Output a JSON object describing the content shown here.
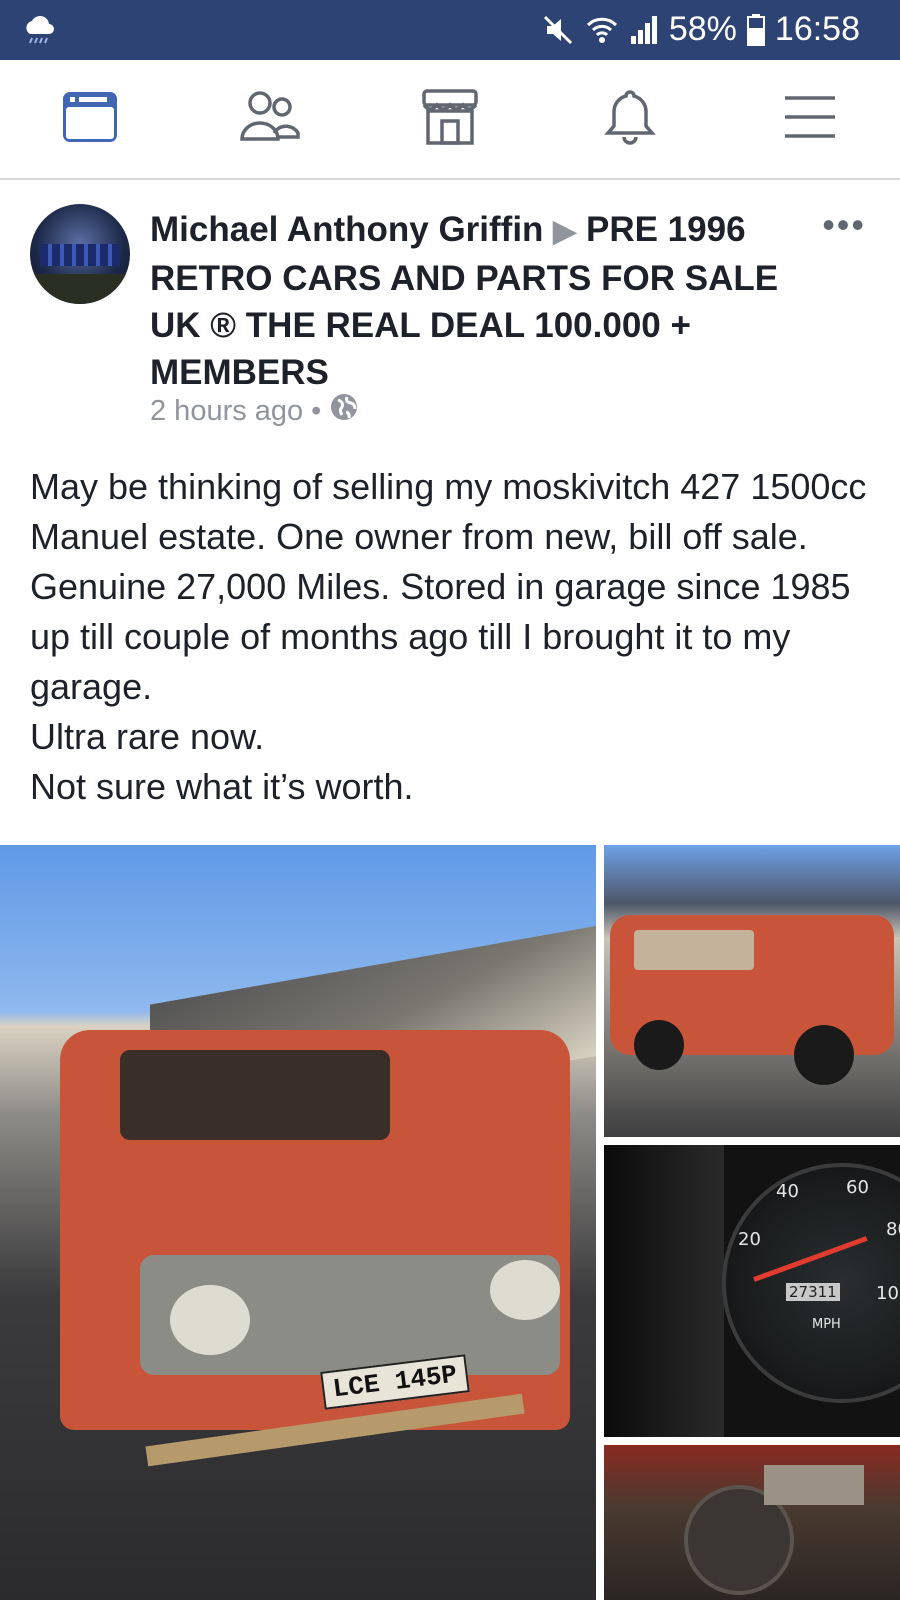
{
  "status_bar": {
    "battery": "58%",
    "time": "16:58",
    "icons": [
      "weather-cloud-icon",
      "mute-icon",
      "wifi-icon",
      "signal-icon",
      "battery-icon"
    ]
  },
  "nav": {
    "items": [
      {
        "name": "news-feed",
        "icon": "news-feed-icon",
        "active": true
      },
      {
        "name": "friends",
        "icon": "friends-icon",
        "active": false
      },
      {
        "name": "marketplace",
        "icon": "marketplace-icon",
        "active": false
      },
      {
        "name": "notifications",
        "icon": "bell-icon",
        "active": false
      },
      {
        "name": "menu",
        "icon": "hamburger-menu-icon",
        "active": false
      }
    ],
    "active_color": "#4267b2",
    "inactive_color": "#606770"
  },
  "post": {
    "author": "Michael Anthony Griffin",
    "group": "PRE 1996 RETRO CARS AND PARTS FOR SALE UK ® THE REAL DEAL 100.000 + MEMBERS",
    "timestamp": "2 hours ago",
    "separator": "•",
    "privacy_icon": "globe-icon",
    "more_label": "•••",
    "body_paragraphs": [
      "May be thinking of selling my moskivitch 427 1500cc Manuel estate. One owner from new, bill off sale. Genuine 27,000 Miles. Stored in garage since 1985 up till couple of months ago till I brought it to my garage.",
      "Ultra rare now.",
      "Not sure what it’s worth."
    ],
    "photos": [
      {
        "name": "main-car-photo",
        "plate": "LCE 145P"
      },
      {
        "name": "side-car-photo"
      },
      {
        "name": "speedometer-photo",
        "gauge_labels": [
          "20",
          "40",
          "60",
          "80",
          "10"
        ],
        "unit": "MPH",
        "odometer": "27311"
      },
      {
        "name": "engine-bay-photo"
      }
    ]
  }
}
